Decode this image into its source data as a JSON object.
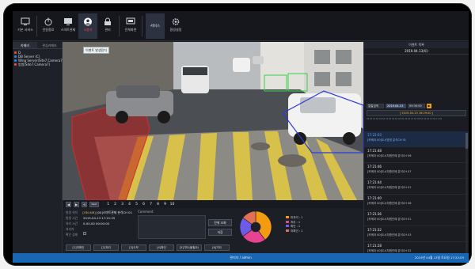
{
  "toolbar": {
    "items": [
      {
        "label": "기본 서비스",
        "icon": "monitor-icon"
      },
      {
        "label": "전원종료",
        "icon": "power-icon"
      },
      {
        "label": "스마트관제",
        "icon": "display-icon"
      },
      {
        "label": "사용자",
        "icon": "user-icon"
      },
      {
        "label": "관리",
        "icon": "lock-icon"
      },
      {
        "label": "전체화면",
        "icon": "fullscreen-icon"
      },
      {
        "label": "서비스",
        "icon": "service-icon"
      },
      {
        "label": "환경설정",
        "icon": "gear-icon"
      }
    ]
  },
  "left": {
    "tabs": [
      "카메라",
      "관심카메라"
    ],
    "tree": [
      {
        "label": "D",
        "color": "#e74c3c"
      },
      {
        "label": "DB Server (C)",
        "color": "#3a7bd5"
      },
      {
        "label": "Wing Server(Site7.Camera7)",
        "color": "#3a7bd5"
      },
      {
        "label": "방범(Site7.Camera7)",
        "color": "#e74c3c"
      }
    ]
  },
  "video": {
    "camera_tag": "이벤트 발생장치"
  },
  "right": {
    "title": "이벤트 목록",
    "date": "2019.04.13(토)",
    "ctrl": {
      "mode": "일일검색",
      "date": "2019.04.13",
      "time": "09:30:00",
      "arrow": "▶"
    },
    "range": "[ 2019-04-13 16:29:00 ]",
    "ruler": "00:00 01:00 02:00 03:00 04:00 05:00 06:00 07:00 08:00 09:00 10:00 11:00",
    "events": [
      {
        "time": "17:22:03",
        "desc": "[카메라 00]도시방범 분석CH 01",
        "selected": true
      },
      {
        "time": "17:21:48",
        "desc": "[카메라 00]도시지원관제 분석CH 06",
        "selected": false
      },
      {
        "time": "17:21:46",
        "desc": "[카메라 00]도시지원관제 분석CH 07",
        "selected": false
      },
      {
        "time": "17:21:44",
        "desc": "[카메라 00]도시지원관제 분석CH 01",
        "selected": false
      },
      {
        "time": "17:21:40",
        "desc": "[카메라 00]도시지원관제 분석CH 08",
        "selected": false
      },
      {
        "time": "17:21:36",
        "desc": "[카메라 00]도시지원관제 분석CH 01",
        "selected": false
      },
      {
        "time": "17:21:32",
        "desc": "[카메라 00]도시지원관제 분석CH 03",
        "selected": false
      },
      {
        "time": "17:21:28",
        "desc": "[카메라 00]도시지원관제 분석CH 02",
        "selected": false
      }
    ]
  },
  "bottom": {
    "ctrl_buttons": [
      "◀",
      "▶",
      "⟲",
      "Next"
    ],
    "pages": [
      "1",
      "2",
      "3",
      "4",
      "5",
      "6",
      "7",
      "8",
      "9",
      "10"
    ],
    "info": [
      {
        "k": "발생 위치",
        "v": "[ON AIR]",
        "v2": "[00]스마트관제 분석CH 01",
        "on": true
      },
      {
        "k": "발생 시간",
        "v": "2019-04-13 17:21:25",
        "v2": "",
        "on": false
      },
      {
        "k": "처리 시간",
        "v": "0-00-00 00:00:00",
        "v2": "",
        "on": false
      },
      {
        "k": "처리자",
        "v": "",
        "v2": "",
        "on": false
      },
      {
        "k": "확인 상태",
        "v": "",
        "v2": "",
        "on": false
      }
    ],
    "comment_label": "Comment",
    "btn_save": "전체 조회",
    "btn_close": "저장",
    "pie": [
      {
        "label": "미처리 : 1",
        "value": 40,
        "color": "#f39c12"
      },
      {
        "label": "처리 : 1",
        "value": 25,
        "color": "#e84393"
      },
      {
        "label": "확인 : 1",
        "value": 20,
        "color": "#6c5ce7"
      },
      {
        "label": "미확인 : 1",
        "value": 15,
        "color": "#e17055"
      }
    ],
    "actions": [
      "[1]미확인",
      "[2]처리",
      "[3]오보",
      "[4]확인",
      "[5]기타(불필요)",
      "[6]기타"
    ]
  },
  "status": {
    "center": "관리자 / admin",
    "right": "2019년 04월 13일 토요일 17:22:03"
  }
}
